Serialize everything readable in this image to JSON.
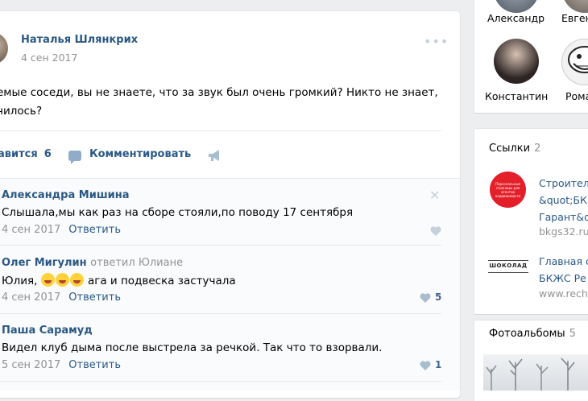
{
  "post": {
    "author": "Наталья Шлянкрих",
    "date": "4 сен 2017",
    "more": "•••",
    "text_line1": "емые соседи, вы не знаете, что за звук был очень громкий? Никто не знает,",
    "text_line2": "чилось?",
    "like_label": "авится",
    "like_count": "6",
    "comment_label": "Комментировать"
  },
  "comments": [
    {
      "author": "Александра Мишина",
      "text": "Слышала,мы как раз на сборе стояли,по поводу 17 сентября",
      "date": "4 сен 2017",
      "reply": "Ответить",
      "likes": ""
    },
    {
      "author": "Олег Мигулин",
      "replied_to": "ответил Юлиане",
      "text_prefix": "Юлия,",
      "text_suffix": "ага и подвеска застучала",
      "date": "4 сен 2017",
      "reply": "Ответить",
      "likes": "5"
    },
    {
      "author": "Паша Сарамуд",
      "text": "Видел клуб дыма после выстрела за речкой. Так что то взорвали.",
      "date": "5 сен 2017",
      "reply": "Ответить",
      "likes": "1"
    }
  ],
  "sidebar": {
    "friends": [
      {
        "name": "Александр"
      },
      {
        "name": "Евгени"
      },
      {
        "name": "Константин"
      },
      {
        "name": "Роман"
      }
    ],
    "links": {
      "title": "Ссылки",
      "count": "2",
      "items": [
        {
          "logo_text": "Персональные страницы для агентов недвижимости",
          "line1": "Строител",
          "line2": "&quot;БК",
          "line3": "Гарант&q",
          "url": "bkgs32.ru"
        },
        {
          "logo_text": "ШОКОЛАД",
          "line1": "Главная с",
          "line2": "БКЖС Ре",
          "url": "www.rech"
        }
      ]
    },
    "photos": {
      "title": "Фотоальбомы",
      "count": "5"
    }
  },
  "colors": {
    "link": "#2a5885",
    "muted": "#939393",
    "background": "#edeef0"
  }
}
